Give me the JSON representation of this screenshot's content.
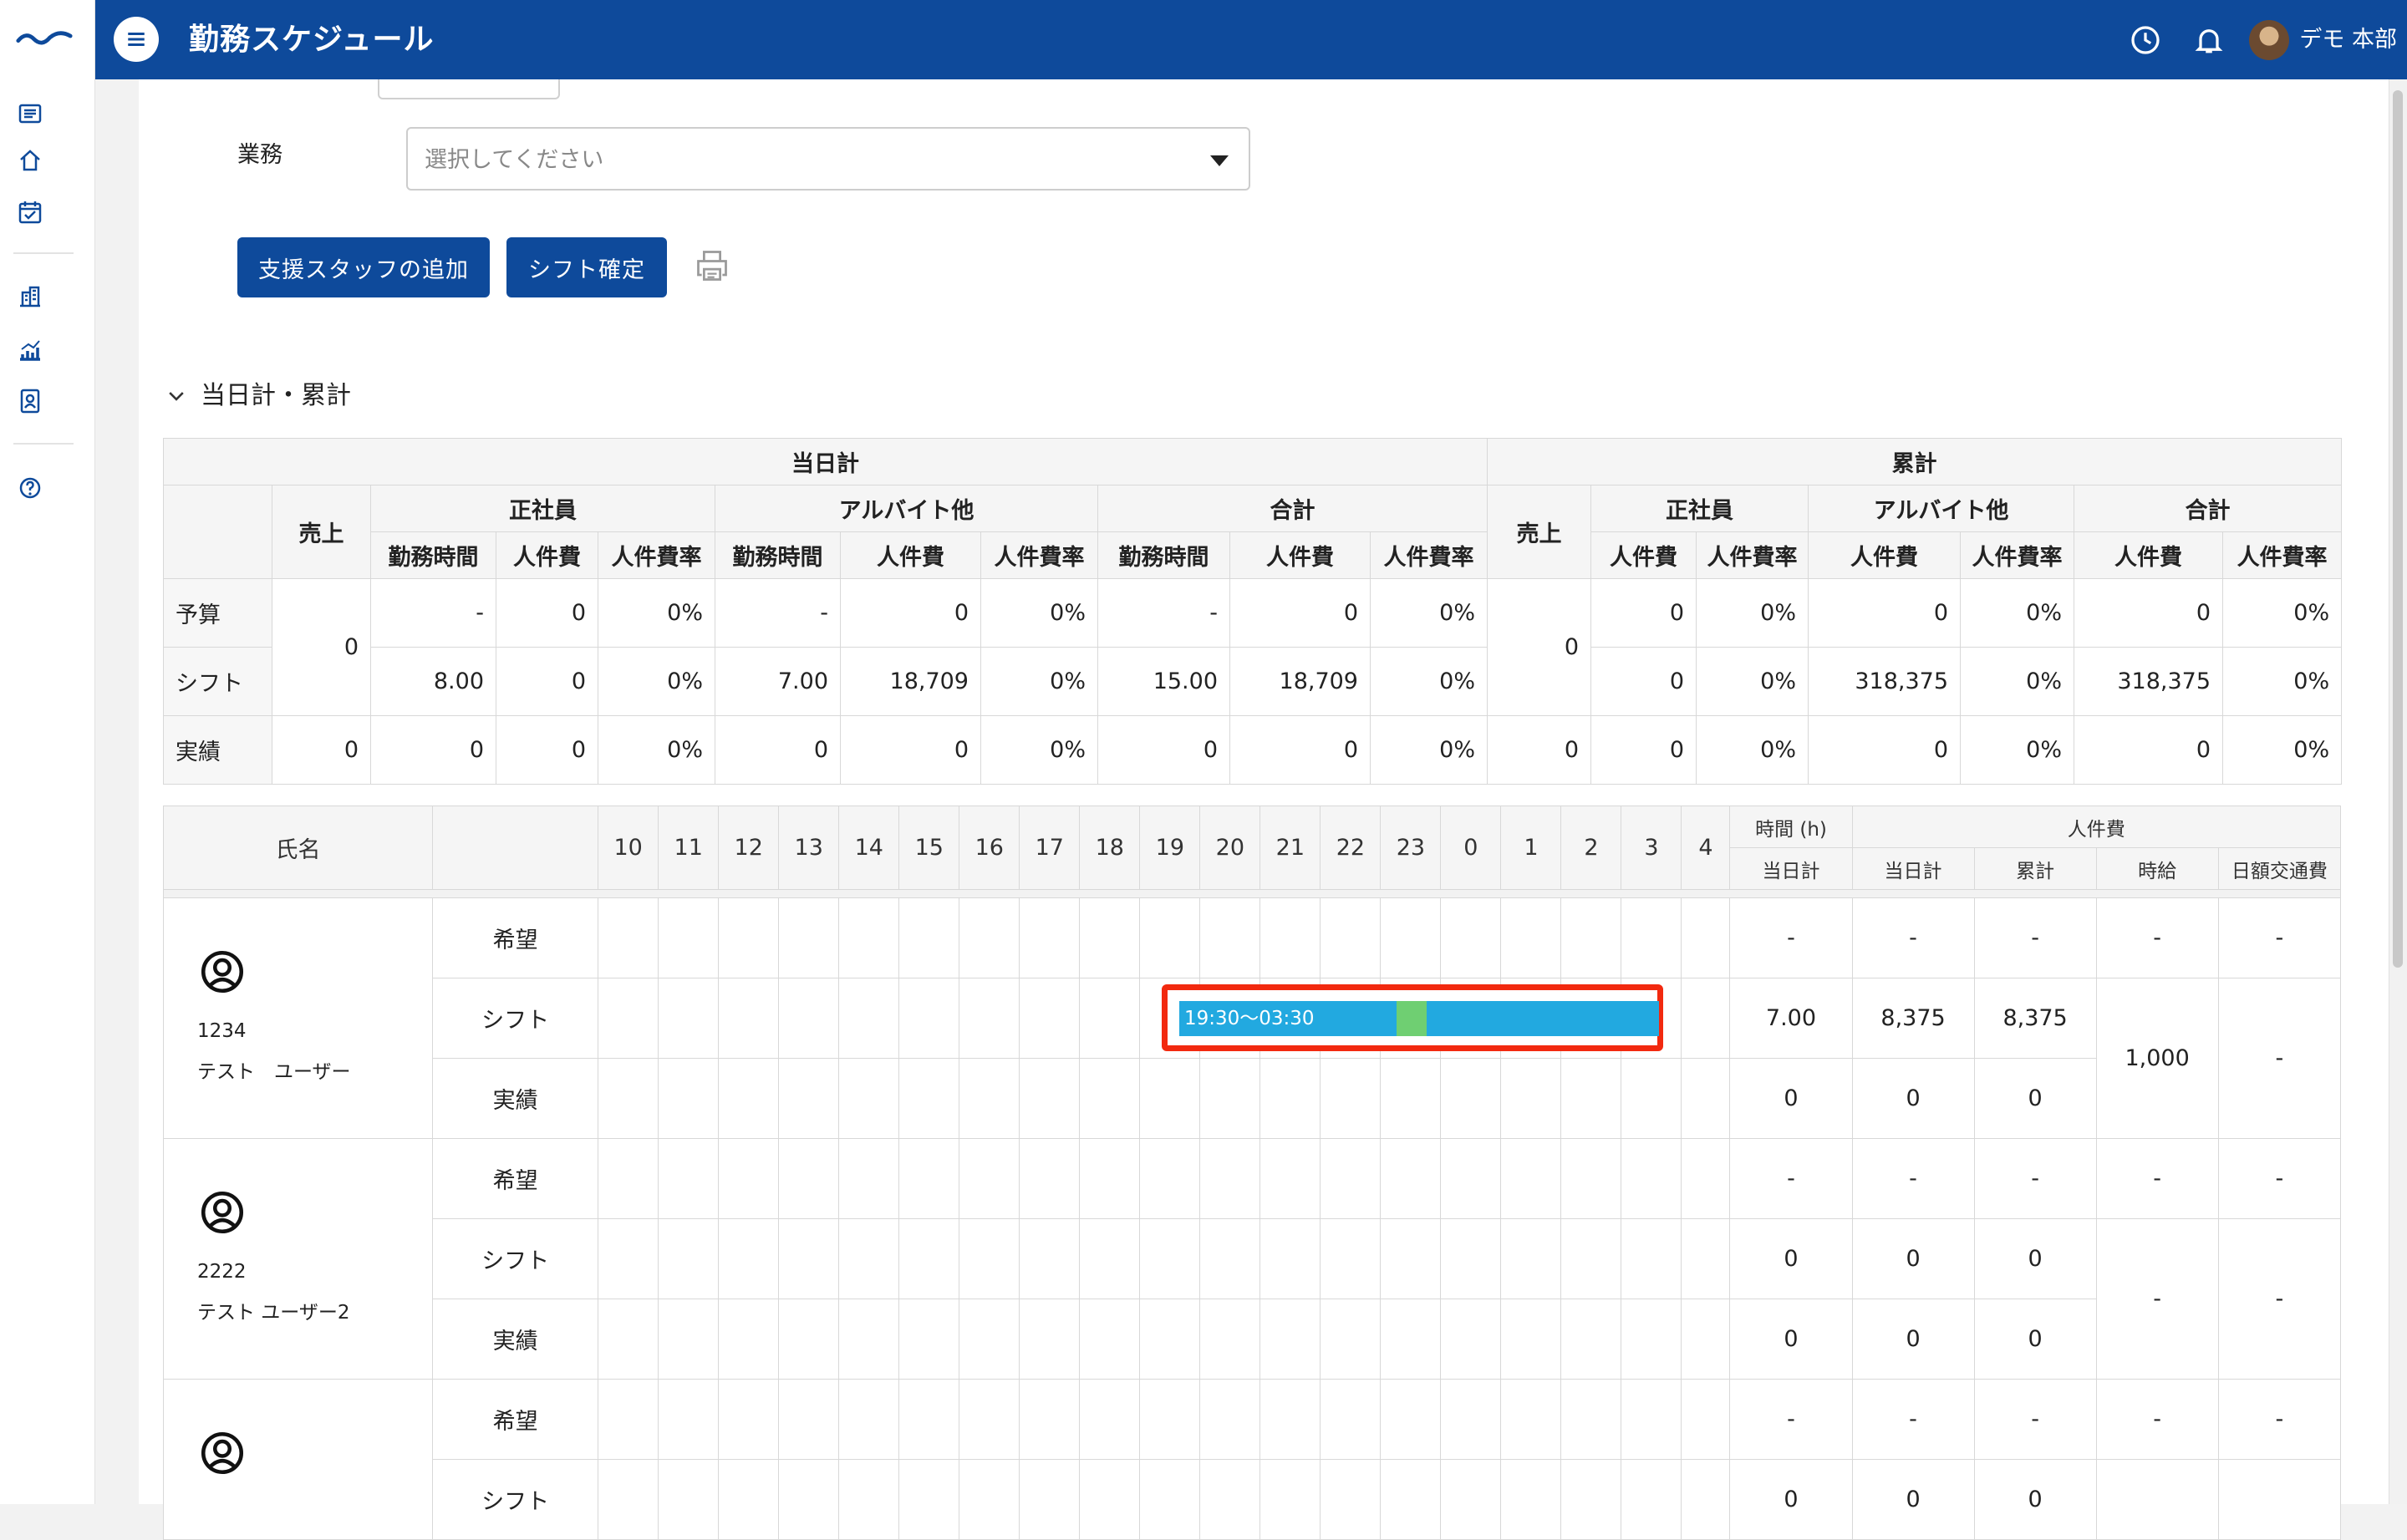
{
  "app": {
    "title": "勤務スケジュール",
    "user_name": "デモ 本部"
  },
  "filters": {
    "task_label": "業務",
    "task_placeholder": "選択してください"
  },
  "actions": {
    "add_support_staff": "支援スタッフの追加",
    "confirm_shift": "シフト確定"
  },
  "summary": {
    "section_title": "当日計・累計",
    "group_day": "当日計",
    "group_cumulative": "累計",
    "col_sales": "売上",
    "col_fulltime": "正社員",
    "col_parttime": "アルバイト他",
    "col_total": "合計",
    "col_work_hours": "勤務時間",
    "col_labor_cost": "人件費",
    "col_labor_rate": "人件費率",
    "rows": [
      {
        "label": "予算",
        "sales": "0",
        "ft_hours": "-",
        "ft_cost": "0",
        "ft_rate": "0%",
        "pt_hours": "-",
        "pt_cost": "0",
        "pt_rate": "0%",
        "t_hours": "-",
        "t_cost": "0",
        "t_rate": "0%",
        "c_sales": "0",
        "c_ft_cost": "0",
        "c_ft_rate": "0%",
        "c_pt_cost": "0",
        "c_pt_rate": "0%",
        "c_t_cost": "0",
        "c_t_rate": "0%"
      },
      {
        "label": "シフト",
        "ft_hours": "8.00",
        "ft_cost": "0",
        "ft_rate": "0%",
        "pt_hours": "7.00",
        "pt_cost": "18,709",
        "pt_rate": "0%",
        "t_hours": "15.00",
        "t_cost": "18,709",
        "t_rate": "0%",
        "c_ft_cost": "0",
        "c_ft_rate": "0%",
        "c_pt_cost": "318,375",
        "c_pt_rate": "0%",
        "c_t_cost": "318,375",
        "c_t_rate": "0%"
      },
      {
        "label": "実績",
        "sales": "0",
        "ft_hours": "0",
        "ft_cost": "0",
        "ft_rate": "0%",
        "pt_hours": "0",
        "pt_cost": "0",
        "pt_rate": "0%",
        "t_hours": "0",
        "t_cost": "0",
        "t_rate": "0%",
        "c_sales": "0",
        "c_ft_cost": "0",
        "c_ft_rate": "0%",
        "c_pt_cost": "0",
        "c_pt_rate": "0%",
        "c_t_cost": "0",
        "c_t_rate": "0%"
      }
    ]
  },
  "schedule": {
    "col_name": "氏名",
    "hours": [
      "10",
      "11",
      "12",
      "13",
      "14",
      "15",
      "16",
      "17",
      "18",
      "19",
      "20",
      "21",
      "22",
      "23",
      "0",
      "1",
      "2",
      "3",
      "4"
    ],
    "col_time": "時間 (h)",
    "col_labor": "人件費",
    "col_day_total": "当日計",
    "col_cumulative": "累計",
    "col_hourly": "時給",
    "col_transport": "日額交通費",
    "row_labels": {
      "wish": "希望",
      "shift": "シフト",
      "actual": "実績"
    },
    "employees": [
      {
        "id": "1234",
        "name": "テスト　ユーザー",
        "hourly": "1,000",
        "transport": "-",
        "wish": {
          "time": "-",
          "day": "-",
          "cum": "-",
          "hourly": "-",
          "transport": "-"
        },
        "shift": {
          "time": "7.00",
          "day": "8,375",
          "cum": "8,375",
          "bar_label": "19:30〜03:30"
        },
        "actual": {
          "time": "0",
          "day": "0",
          "cum": "0"
        }
      },
      {
        "id": "2222",
        "name": "テスト ユーザー2",
        "hourly": "-",
        "transport": "-",
        "wish": {
          "time": "-",
          "day": "-",
          "cum": "-",
          "hourly": "-",
          "transport": "-"
        },
        "shift": {
          "time": "0",
          "day": "0",
          "cum": "0"
        },
        "actual": {
          "time": "0",
          "day": "0",
          "cum": "0"
        }
      },
      {
        "wish": {
          "time": "-",
          "day": "-",
          "cum": "-",
          "hourly": "-",
          "transport": "-"
        },
        "shift": {
          "time": "0",
          "day": "0",
          "cum": "0"
        }
      }
    ]
  },
  "colors": {
    "header": "#0e4a9b",
    "shift_bar": "#22a9e0",
    "break": "#6fcf72",
    "highlight": "#f2290f"
  }
}
